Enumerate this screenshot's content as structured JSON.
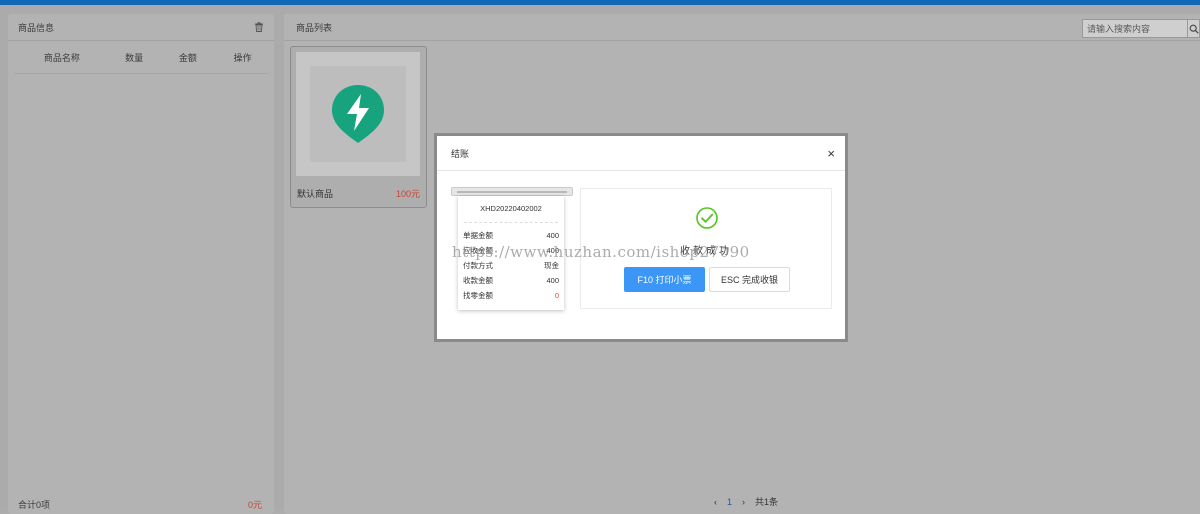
{
  "colors": {
    "topbar": "#1169b8",
    "primary": "#3b96f5",
    "price": "#c9432f",
    "success": "#52c41a",
    "brand_icon": "#16a37d"
  },
  "left_panel": {
    "title": "商品信息",
    "trash_icon": "trash-icon",
    "columns": [
      "商品名称",
      "数量",
      "金额",
      "操作"
    ],
    "total_label": "合计0项",
    "total_amount": "0元"
  },
  "right_panel": {
    "title": "商品列表",
    "search": {
      "placeholder": "请输入搜索内容",
      "value": ""
    },
    "search_icon": "search-icon",
    "products": [
      {
        "name": "默认商品",
        "price": "100元",
        "icon": "lightning-pin-icon"
      }
    ],
    "pagination": {
      "prev": "‹",
      "page": "1",
      "next": "›",
      "total": "共1条"
    }
  },
  "modal": {
    "title": "结账",
    "close": "×",
    "receipt": {
      "order_no": "XHD20220402002",
      "rows": [
        {
          "label": "单据金额",
          "value": "400"
        },
        {
          "label": "应收金额",
          "value": "400"
        },
        {
          "label": "付款方式",
          "value": "现金"
        },
        {
          "label": "收款金额",
          "value": "400"
        },
        {
          "label": "找零金额",
          "value": "0"
        }
      ]
    },
    "success_text": "收款成功",
    "print_button": "F10 打印小票",
    "finish_button": "ESC 完成收银"
  },
  "watermark": "https://www.huzhan.com/ishop27090"
}
